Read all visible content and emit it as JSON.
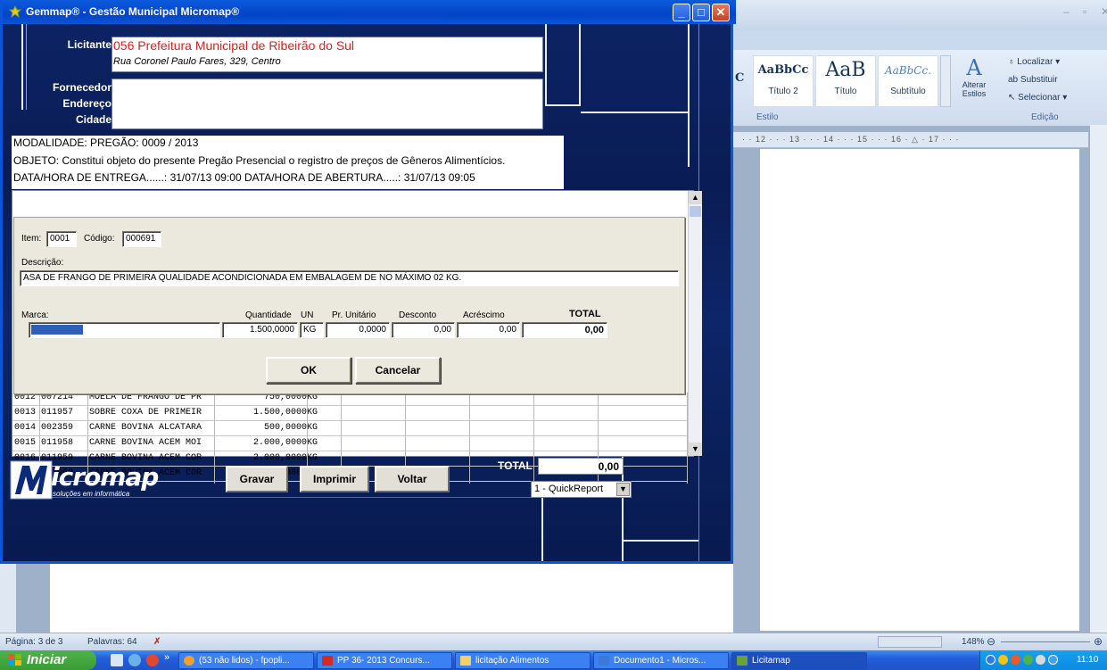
{
  "word": {
    "style_samples": [
      {
        "sample": "AaBbCc",
        "caption": "Título 2"
      },
      {
        "sample": "AaB",
        "caption": "Título"
      },
      {
        "sample": "AaBbCc.",
        "caption": "Subtítulo"
      }
    ],
    "partial_sample": "C",
    "change_styles_label": "Alterar Estilos",
    "group_style_label": "Estilo",
    "group_edit_label": "Edição",
    "find_label": "Localizar",
    "replace_label": "Substituir",
    "select_label": "Selecionar",
    "ruler_text": "· · 12 · · · 13 · · · 14 · · · 15 · · · 16 · △ · 17 · · ·",
    "status_page": "Página: 3 de 3",
    "status_words": "Palavras: 64",
    "zoom_level": "148%"
  },
  "taskbar": {
    "start_label": "Iniciar",
    "more_label": "»",
    "tasks": [
      {
        "label": "(53 não lidos) - fpopli...",
        "color": "#f2a02c"
      },
      {
        "label": "PP 36- 2013 Concurs...",
        "color": "#d42a21"
      },
      {
        "label": "licitação Alimentos",
        "color": "#f4d06b"
      },
      {
        "label": "Documento1 - Micros...",
        "color": "#3c78d8"
      },
      {
        "label": "Licitamap",
        "color": "#6aa13f"
      }
    ],
    "clock": "11:10"
  },
  "gemmap": {
    "title": "Gemmap® - Gestão Municipal Micromap®",
    "labels": {
      "licitante": "Licitante",
      "fornecedor": "Fornecedor",
      "endereco": "Endereço",
      "cidade": "Cidade"
    },
    "licitante_name": "056 Prefeitura Municipal de Ribeirão do Sul",
    "licitante_address": "Rua Coronel Paulo Fares, 329, Centro",
    "info_lines": [
      "MODALIDADE: PREGÃO: 0009 / 2013",
      "OBJETO: Constitui objeto do presente Pregão Presencial o registro de preços de Gêneros Alimentícios.",
      "DATA/HORA DE ENTREGA......: 31/07/13 09:00  DATA/HORA DE ABERTURA.....: 31/07/13 09:05"
    ],
    "grid_rows": [
      {
        "item": "0012",
        "code": "007214",
        "desc": "MOELA DE FRANGO DE PR",
        "qty": "750,0000",
        "un": "KG"
      },
      {
        "item": "0013",
        "code": "011957",
        "desc": "SOBRE COXA DE PRIMEIR",
        "qty": "1.500,0000",
        "un": "KG"
      },
      {
        "item": "0014",
        "code": "002359",
        "desc": "CARNE BOVINA ALCATARA",
        "qty": "500,0000",
        "un": "KG"
      },
      {
        "item": "0015",
        "code": "011958",
        "desc": "CARNE BOVINA ACEM MOI",
        "qty": "2.000,0000",
        "un": "KG"
      },
      {
        "item": "0016",
        "code": "011959",
        "desc": "CARNE BOVINA ACEM COR",
        "qty": "2.000,0000",
        "un": "KG"
      },
      {
        "item": "0017",
        "code": "011960",
        "desc": "CARNE BOVINA ACEM COR",
        "qty": "500,0000",
        "un": "KG"
      }
    ],
    "total_label": "TOTAL",
    "total_value": "0,00",
    "report_select": "1 - QuickReport",
    "buttons": {
      "gravar": "Gravar",
      "imprimir": "Imprimir",
      "voltar": "Voltar"
    },
    "logo_text": "icromap",
    "logo_tagline": "soluções em informática"
  },
  "dialog": {
    "item_label": "Item:",
    "item_value": "0001",
    "code_label": "Código:",
    "code_value": "000691",
    "desc_label": "Descrição:",
    "desc_value": "ASA DE FRANGO DE PRIMEIRA QUALIDADE ACONDICIONADA EM EMBALAGEM DE NO MÁXIMO 02 KG.",
    "marca_label": "Marca:",
    "qty_label": "Quantidade",
    "un_label": "UN",
    "unit_price_label": "Pr. Unitário",
    "discount_label": "Desconto",
    "surcharge_label": "Acréscimo",
    "total_label": "TOTAL",
    "qty_value": "1.500,0000",
    "un_value": "KG",
    "unit_price_value": "0,0000",
    "discount_value": "0,00",
    "surcharge_value": "0,00",
    "total_value": "0,00",
    "ok_label": "OK",
    "cancel_label": "Cancelar"
  }
}
